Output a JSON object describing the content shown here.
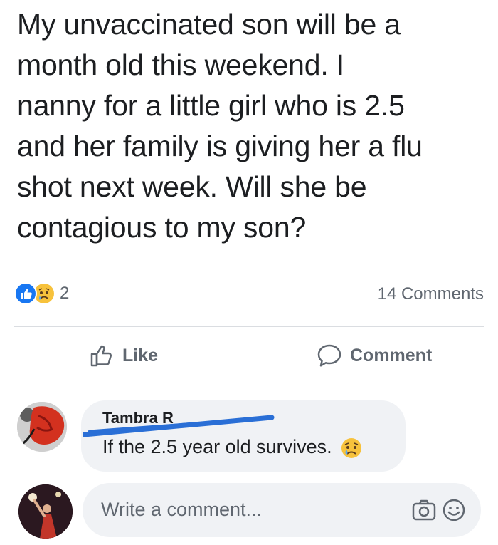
{
  "post": {
    "lines": [
      "My unvaccinated son will be a",
      "month old this weekend. I",
      "nanny for a little girl who is 2.5",
      "and her family is giving her a flu",
      "shot next week. Will she be",
      "contagious to my son?"
    ]
  },
  "stats": {
    "reaction_count": "2",
    "comments_count": "14 Comments",
    "reactions": [
      "like-icon",
      "sad-icon"
    ]
  },
  "actions": {
    "like_label": "Like",
    "comment_label": "Comment"
  },
  "comment": {
    "author": "Tambra R",
    "text": "If the 2.5 year old survives.",
    "emoji": "sad-tear-icon"
  },
  "composer": {
    "placeholder": "Write a comment..."
  },
  "colors": {
    "like_blue": "#1877f2",
    "sad_yellow": "#f7c23c",
    "scribble_blue": "#2a6fd6",
    "muted": "#606770",
    "bubble": "#f0f2f5"
  }
}
